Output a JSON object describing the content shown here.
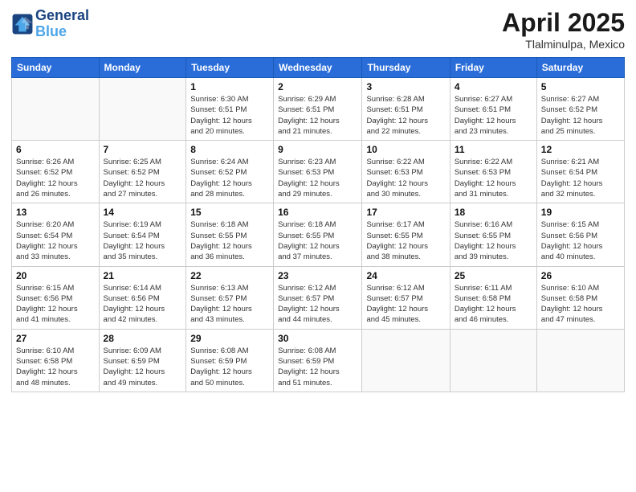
{
  "logo": {
    "line1": "General",
    "line2": "Blue"
  },
  "title": "April 2025",
  "location": "Tlalminulpa, Mexico",
  "weekdays": [
    "Sunday",
    "Monday",
    "Tuesday",
    "Wednesday",
    "Thursday",
    "Friday",
    "Saturday"
  ],
  "weeks": [
    [
      {
        "day": "",
        "info": ""
      },
      {
        "day": "",
        "info": ""
      },
      {
        "day": "1",
        "info": "Sunrise: 6:30 AM\nSunset: 6:51 PM\nDaylight: 12 hours\nand 20 minutes."
      },
      {
        "day": "2",
        "info": "Sunrise: 6:29 AM\nSunset: 6:51 PM\nDaylight: 12 hours\nand 21 minutes."
      },
      {
        "day": "3",
        "info": "Sunrise: 6:28 AM\nSunset: 6:51 PM\nDaylight: 12 hours\nand 22 minutes."
      },
      {
        "day": "4",
        "info": "Sunrise: 6:27 AM\nSunset: 6:51 PM\nDaylight: 12 hours\nand 23 minutes."
      },
      {
        "day": "5",
        "info": "Sunrise: 6:27 AM\nSunset: 6:52 PM\nDaylight: 12 hours\nand 25 minutes."
      }
    ],
    [
      {
        "day": "6",
        "info": "Sunrise: 6:26 AM\nSunset: 6:52 PM\nDaylight: 12 hours\nand 26 minutes."
      },
      {
        "day": "7",
        "info": "Sunrise: 6:25 AM\nSunset: 6:52 PM\nDaylight: 12 hours\nand 27 minutes."
      },
      {
        "day": "8",
        "info": "Sunrise: 6:24 AM\nSunset: 6:52 PM\nDaylight: 12 hours\nand 28 minutes."
      },
      {
        "day": "9",
        "info": "Sunrise: 6:23 AM\nSunset: 6:53 PM\nDaylight: 12 hours\nand 29 minutes."
      },
      {
        "day": "10",
        "info": "Sunrise: 6:22 AM\nSunset: 6:53 PM\nDaylight: 12 hours\nand 30 minutes."
      },
      {
        "day": "11",
        "info": "Sunrise: 6:22 AM\nSunset: 6:53 PM\nDaylight: 12 hours\nand 31 minutes."
      },
      {
        "day": "12",
        "info": "Sunrise: 6:21 AM\nSunset: 6:54 PM\nDaylight: 12 hours\nand 32 minutes."
      }
    ],
    [
      {
        "day": "13",
        "info": "Sunrise: 6:20 AM\nSunset: 6:54 PM\nDaylight: 12 hours\nand 33 minutes."
      },
      {
        "day": "14",
        "info": "Sunrise: 6:19 AM\nSunset: 6:54 PM\nDaylight: 12 hours\nand 35 minutes."
      },
      {
        "day": "15",
        "info": "Sunrise: 6:18 AM\nSunset: 6:55 PM\nDaylight: 12 hours\nand 36 minutes."
      },
      {
        "day": "16",
        "info": "Sunrise: 6:18 AM\nSunset: 6:55 PM\nDaylight: 12 hours\nand 37 minutes."
      },
      {
        "day": "17",
        "info": "Sunrise: 6:17 AM\nSunset: 6:55 PM\nDaylight: 12 hours\nand 38 minutes."
      },
      {
        "day": "18",
        "info": "Sunrise: 6:16 AM\nSunset: 6:55 PM\nDaylight: 12 hours\nand 39 minutes."
      },
      {
        "day": "19",
        "info": "Sunrise: 6:15 AM\nSunset: 6:56 PM\nDaylight: 12 hours\nand 40 minutes."
      }
    ],
    [
      {
        "day": "20",
        "info": "Sunrise: 6:15 AM\nSunset: 6:56 PM\nDaylight: 12 hours\nand 41 minutes."
      },
      {
        "day": "21",
        "info": "Sunrise: 6:14 AM\nSunset: 6:56 PM\nDaylight: 12 hours\nand 42 minutes."
      },
      {
        "day": "22",
        "info": "Sunrise: 6:13 AM\nSunset: 6:57 PM\nDaylight: 12 hours\nand 43 minutes."
      },
      {
        "day": "23",
        "info": "Sunrise: 6:12 AM\nSunset: 6:57 PM\nDaylight: 12 hours\nand 44 minutes."
      },
      {
        "day": "24",
        "info": "Sunrise: 6:12 AM\nSunset: 6:57 PM\nDaylight: 12 hours\nand 45 minutes."
      },
      {
        "day": "25",
        "info": "Sunrise: 6:11 AM\nSunset: 6:58 PM\nDaylight: 12 hours\nand 46 minutes."
      },
      {
        "day": "26",
        "info": "Sunrise: 6:10 AM\nSunset: 6:58 PM\nDaylight: 12 hours\nand 47 minutes."
      }
    ],
    [
      {
        "day": "27",
        "info": "Sunrise: 6:10 AM\nSunset: 6:58 PM\nDaylight: 12 hours\nand 48 minutes."
      },
      {
        "day": "28",
        "info": "Sunrise: 6:09 AM\nSunset: 6:59 PM\nDaylight: 12 hours\nand 49 minutes."
      },
      {
        "day": "29",
        "info": "Sunrise: 6:08 AM\nSunset: 6:59 PM\nDaylight: 12 hours\nand 50 minutes."
      },
      {
        "day": "30",
        "info": "Sunrise: 6:08 AM\nSunset: 6:59 PM\nDaylight: 12 hours\nand 51 minutes."
      },
      {
        "day": "",
        "info": ""
      },
      {
        "day": "",
        "info": ""
      },
      {
        "day": "",
        "info": ""
      }
    ]
  ]
}
